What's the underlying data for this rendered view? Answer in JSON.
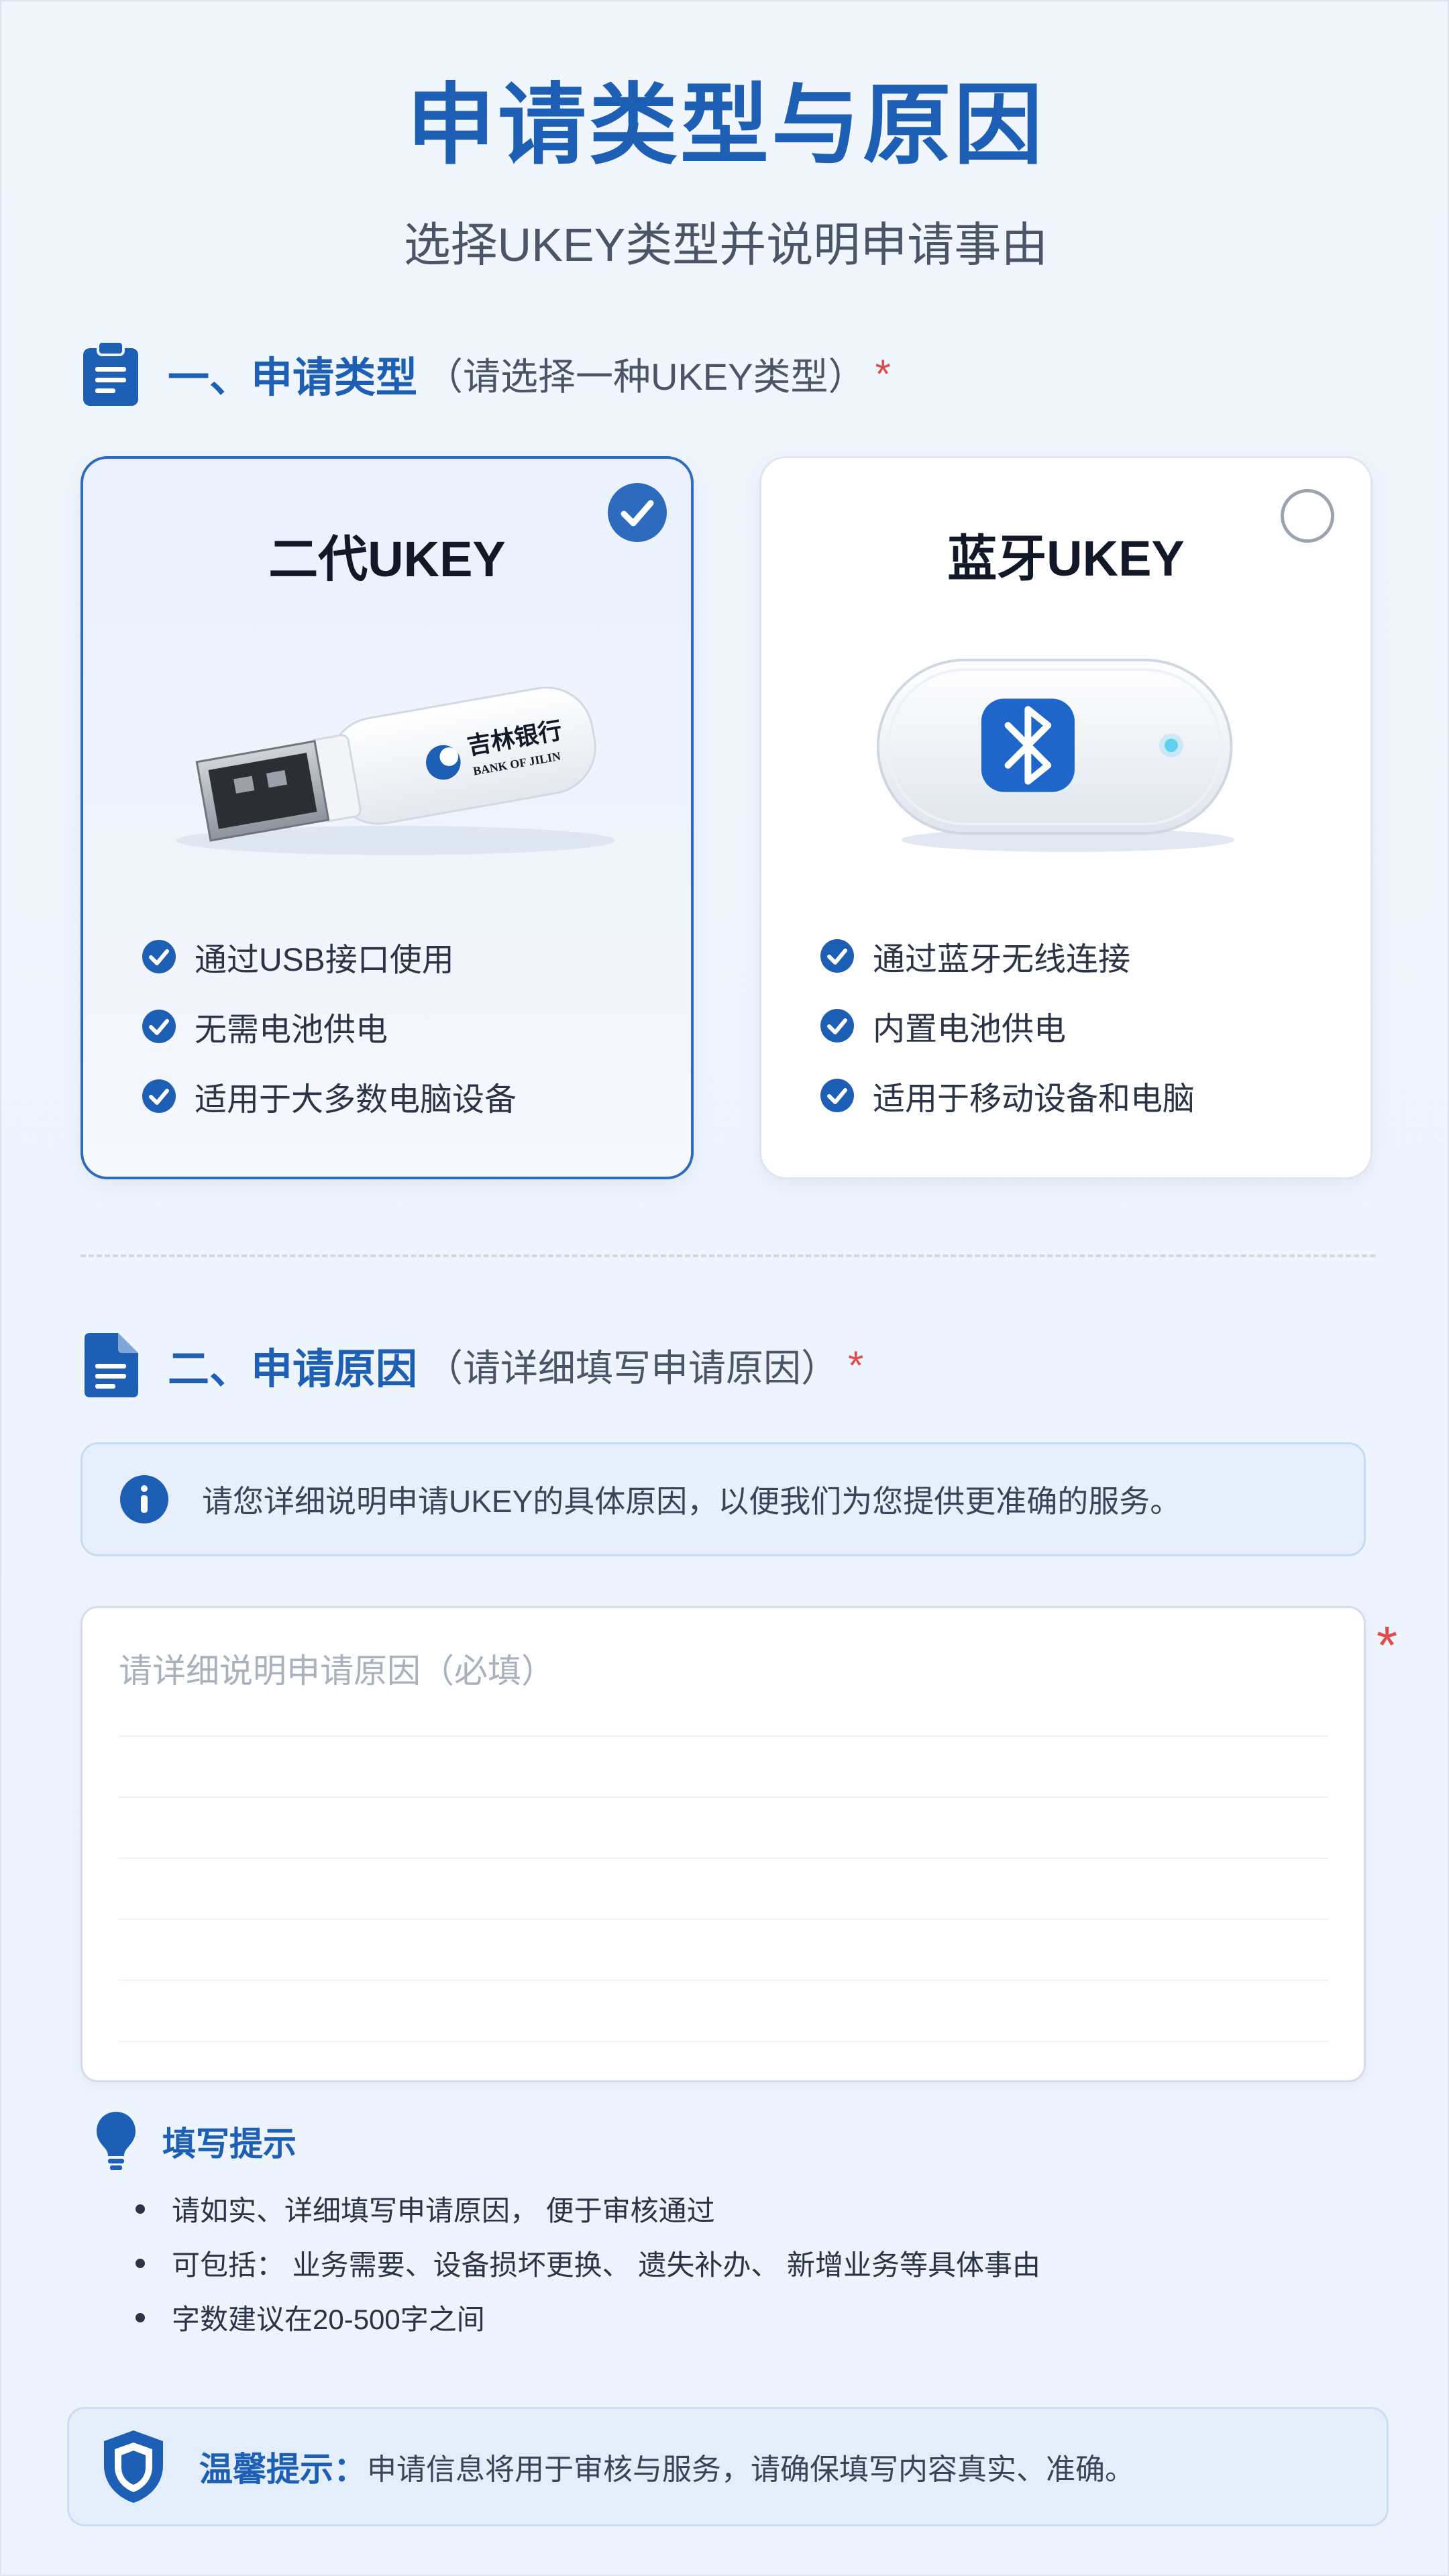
{
  "header": {
    "title": "申请类型与原因",
    "subtitle": "选择UKEY类型并说明申请事由"
  },
  "section1": {
    "title": "一、申请类型",
    "hint": "（请选择一种UKEY类型）",
    "required_mark": "*"
  },
  "options": [
    {
      "name": "二代UKEY",
      "selected": true,
      "device_icon": "usb-key-icon",
      "brand_cn": "吉林银行",
      "brand_en": "BANK OF JILIN",
      "features": [
        "通过USB接口使用",
        "无需电池供电",
        "适用于大多数电脑设备"
      ]
    },
    {
      "name": "蓝牙UKEY",
      "selected": false,
      "device_icon": "bluetooth-key-icon",
      "features": [
        "通过蓝牙无线连接",
        "内置电池供电",
        "适用于移动设备和电脑"
      ]
    }
  ],
  "section2": {
    "title": "二、申请原因",
    "hint": "（请详细填写申请原因）",
    "required_mark": "*"
  },
  "info_box": {
    "text": "请您详细说明申请UKEY的具体原因，以便我们为您提供更准确的服务。"
  },
  "reason_field": {
    "placeholder": "请详细说明申请原因（必填）",
    "value": "",
    "required_mark": "*"
  },
  "tips": {
    "title": "填写提示",
    "items": [
      "请如实、详细填写申请原因， 便于审核通过",
      "可包括： 业务需要、设备损坏更换、 遗失补办、 新增业务等具体事由",
      "字数建议在20-500字之间"
    ]
  },
  "notice": {
    "label": "温馨提示：",
    "text": "申请信息将用于审核与服务，请确保填写内容真实、准确。"
  },
  "colors": {
    "primary": "#1d5fb5",
    "accent": "#2d6bbf",
    "required": "#e24b4b",
    "background": "#eef4fc"
  }
}
